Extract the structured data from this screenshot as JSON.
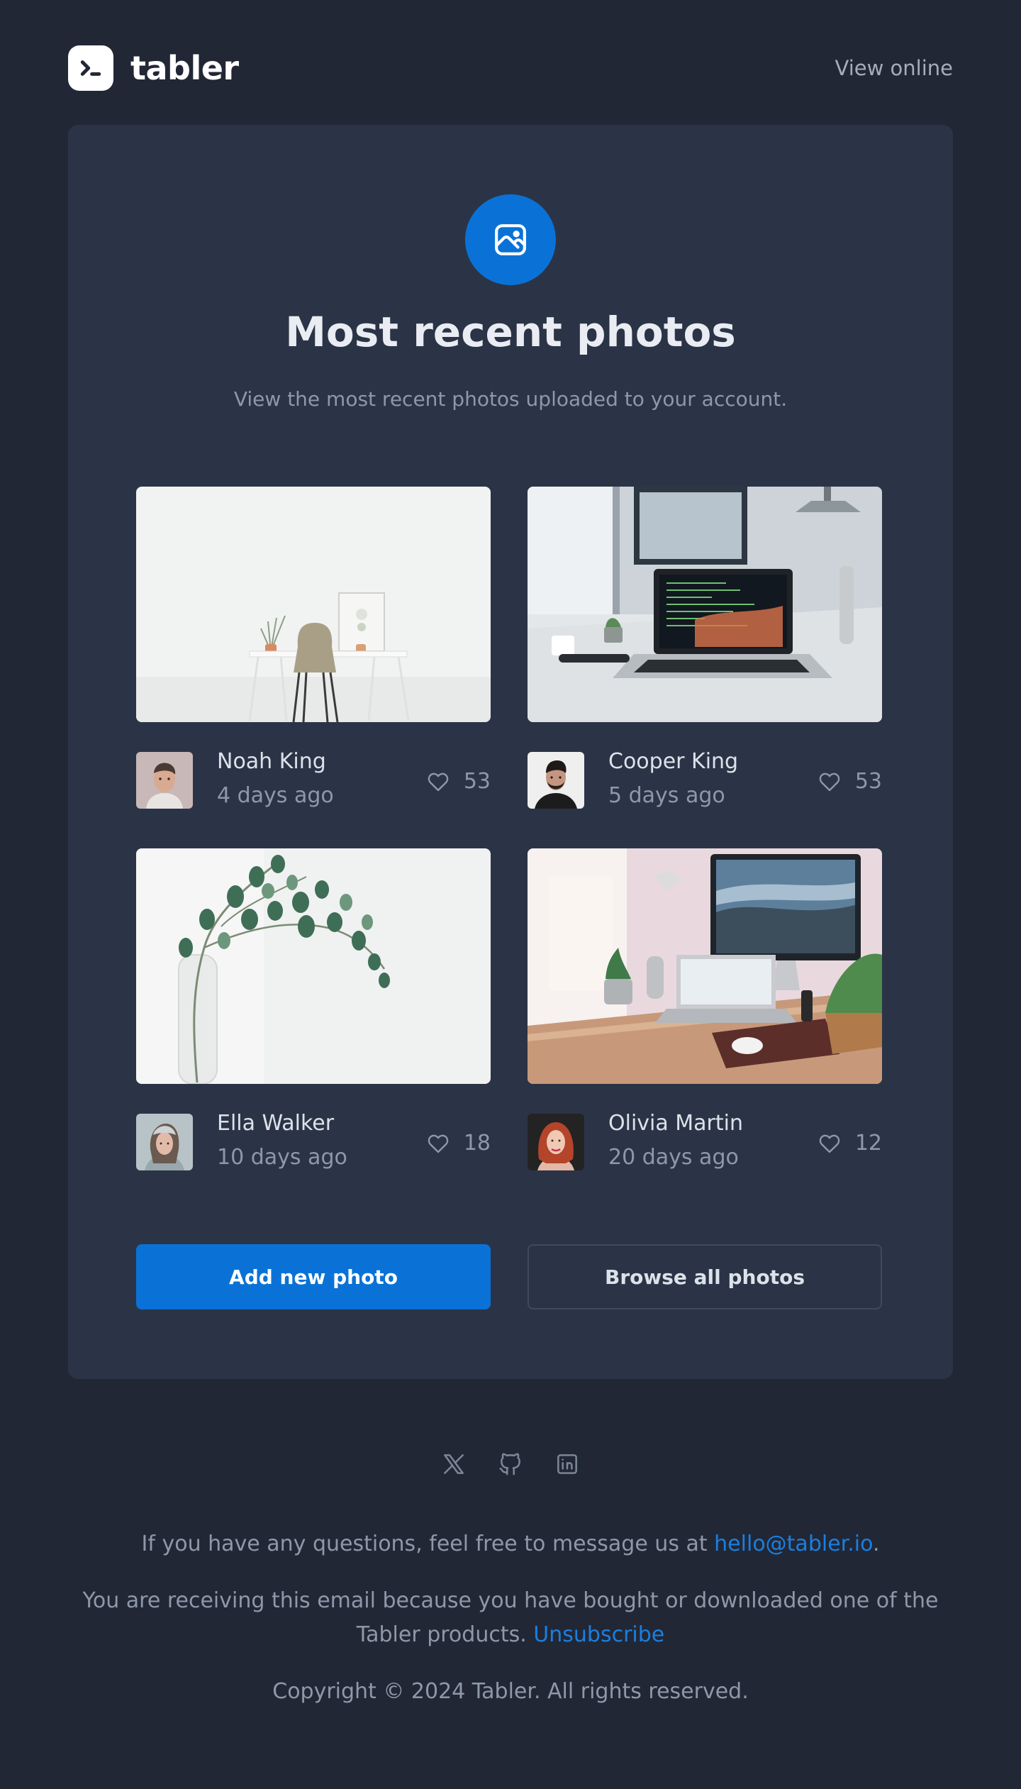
{
  "header": {
    "brand_name": "tabler",
    "view_online": "View online"
  },
  "hero": {
    "icon": "photo-icon",
    "title": "Most recent photos",
    "subtitle": "View the most recent photos uploaded to your account."
  },
  "photos": [
    {
      "author": "Noah King",
      "time": "4 days ago",
      "likes": "53",
      "image": "minimal-desk-chair"
    },
    {
      "author": "Cooper King",
      "time": "5 days ago",
      "likes": "53",
      "image": "laptop-code-desk"
    },
    {
      "author": "Ella Walker",
      "time": "10 days ago",
      "likes": "18",
      "image": "eucalyptus-vase"
    },
    {
      "author": "Olivia Martin",
      "time": "20 days ago",
      "likes": "12",
      "image": "home-office-imac"
    }
  ],
  "buttons": {
    "primary": "Add new photo",
    "secondary": "Browse all photos"
  },
  "footer": {
    "socials": [
      "x-icon",
      "github-icon",
      "linkedin-icon"
    ],
    "questions_text": "If you have any questions, feel free to message us at ",
    "email": "hello@tabler.io",
    "period": ".",
    "receiving_text": "You are receiving this email because you have bought or downloaded one of the Tabler products. ",
    "unsubscribe": "Unsubscribe",
    "copyright": "Copyright © 2024 Tabler. All rights reserved."
  },
  "colors": {
    "background": "#222736",
    "card": "#2b3446",
    "accent": "#0a72d6",
    "muted_text": "#8e98a8"
  }
}
